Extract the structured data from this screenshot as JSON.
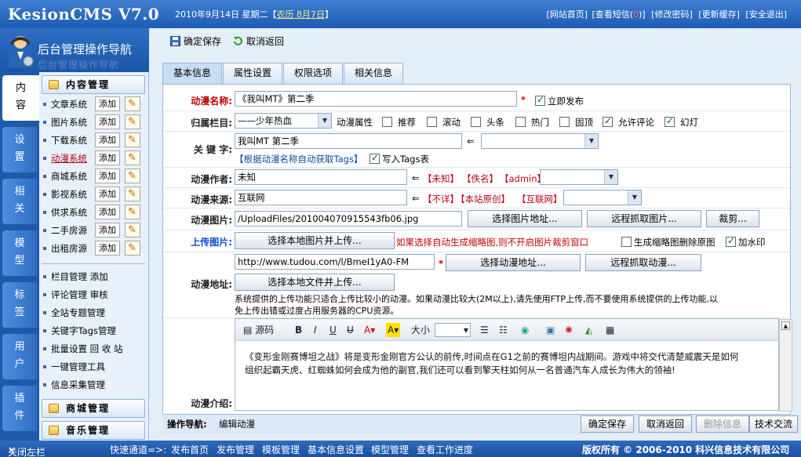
{
  "header": {
    "logo": "KesionCMS V7.0",
    "date_prefix": "2010年9月14日 星期二【",
    "lunar": "农历 8月7日",
    "date_suffix": "】",
    "links": [
      "[网站首页]",
      "[查看短信(",
      "0",
      ")]",
      "[修改密码]",
      "[更新缓存]",
      "[安全退出]"
    ]
  },
  "nav": {
    "title": "后台管理操作导航",
    "shadow": "后台管理操作导航",
    "vtabs": [
      {
        "label": "内\n容"
      },
      {
        "label": "设\n置"
      },
      {
        "label": "相\n关"
      },
      {
        "label": "模\n型"
      },
      {
        "label": "标\n签"
      },
      {
        "label": "用\n户"
      },
      {
        "label": "插\n件"
      }
    ],
    "groups": [
      "内容管理",
      "商城管理",
      "音乐管理"
    ],
    "systems": [
      "文章系统",
      "图片系统",
      "下载系统",
      "动漫系统",
      "商城系统",
      "影视系统",
      "供求系统",
      "二手房源",
      "出租房源"
    ],
    "add_label": "添加",
    "links": [
      "栏目管理 添加",
      "评论管理 审核",
      "全站专题管理",
      "关键字Tags管理",
      "批量设置 回 收 站",
      "一键管理工具",
      "信息采集管理"
    ]
  },
  "toolbar": {
    "save": "确定保存",
    "cancel": "取消返回"
  },
  "tabs": [
    "基本信息",
    "属性设置",
    "权限选项",
    "相关信息"
  ],
  "form": {
    "name_label": "动漫名称:",
    "name_value": "《我叫MT》第二季",
    "publish_label": "立即发布",
    "column_label": "归属栏目:",
    "column_value": "——少年热血",
    "attr_label": "动漫属性",
    "attrs": [
      "推荐",
      "滚动",
      "头条",
      "热门",
      "固顶",
      "允许评论",
      "幻灯"
    ],
    "keyword_label": "关 键 字:",
    "keyword_value": "我叫MT 第二季",
    "arrow": "⇐",
    "auto_tags": "【根据动漫名称自动获取Tags】",
    "write_tags": "写入Tags表",
    "author_label": "动漫作者:",
    "author_value": "未知",
    "author_quick": [
      "【未知】",
      "【佚名】",
      "【admin】"
    ],
    "source_label": "动漫来源:",
    "source_value": "互联网",
    "source_quick": [
      "【不详】",
      "【本站原创】",
      "【互联网】"
    ],
    "image_label": "动漫图片:",
    "image_value": "/UploadFiles/201004070915543fb06.jpg",
    "choose_image": "选择图片地址...",
    "remote_image": "远程抓取图片...",
    "crop": "裁剪...",
    "upload_label": "上传图片:",
    "upload_btn": "选择本地图片并上传...",
    "upload_hint": "如果选择自动生成缩略图,则不开启图片裁剪窗口",
    "thumb_opt": "生成缩略图删除原图",
    "watermark": "加水印",
    "url_label": "动漫地址:",
    "url_value": "http://www.tudou.com/l/BmeI1yA0-FM",
    "choose_url": "选择动漫地址...",
    "remote_url": "远程抓取动漫...",
    "upload_file": "选择本地文件并上传...",
    "url_note1": "系统提供的上传功能只适合上传比较小的动漫。如果动漫比较大(2M以上),请先使用FTP上传,而不要使用系统提供的上传功能,以",
    "url_note2": "免上传出错或过度占用服务器的CPU资源。",
    "intro_label": "动漫介绍:",
    "editor_source": "源码",
    "editor_fontsize": "大小",
    "intro_text1": "《变形金刚赛博坦之战》将是变形金刚官方公认的前传,时间点在G1之前的赛博坦内战期间。游戏中将交代清楚威震天是如何",
    "intro_text2": "组织起霸天虎、红蜘蛛如何会成为他的副官,我们还可以看到擎天柱如何从一名普通汽车人成长为伟大的领袖!"
  },
  "bottom": {
    "op_label": "操作导航:",
    "op_value": "编辑动漫",
    "buttons": [
      "确定保存",
      "取消返回",
      "删除信息",
      "技术交流"
    ]
  },
  "status": {
    "close_left": "关闭左栏",
    "quick_label": "快速通道=>:",
    "links": [
      "发布首页",
      "发布管理",
      "模板管理",
      "基本信息设置",
      "模型管理",
      "查看工作进度"
    ],
    "copyright": "版权所有 © 2006-2010 科兴信息技术有限公司"
  },
  "colors": {
    "accent": "#1d5cb4",
    "warning": "#c80000",
    "link_blue": "#0b4bd1"
  }
}
